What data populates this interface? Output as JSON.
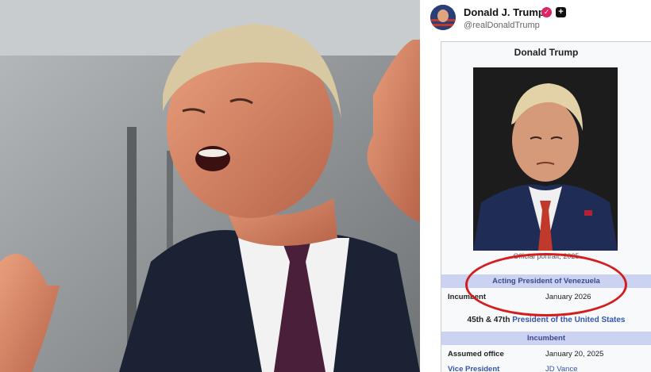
{
  "post": {
    "author_name": "Donald J. Trump",
    "handle": "@realDonaldTrump",
    "verified_icon": "verified-badge-icon",
    "plus_icon": "plus-icon"
  },
  "infobox": {
    "title": "Donald Trump",
    "caption": "Official portrait, 2025",
    "acting_header": "Acting President of Venezuela",
    "incumbent_label": "Incumbent",
    "incumbent_value": "January 2026",
    "office_prefix": "45th & 47th",
    "office_link": "President of the United States",
    "incumbent_header": "Incumbent",
    "assumed_office_label": "Assumed office",
    "assumed_office_value": "January 20, 2025",
    "vice_president_label": "Vice President",
    "vice_president_value": "JD Vance"
  },
  "colors": {
    "highlight_circle": "#d41e1e",
    "infobox_header_bg": "#ccd2f2",
    "link": "#3355aa"
  }
}
